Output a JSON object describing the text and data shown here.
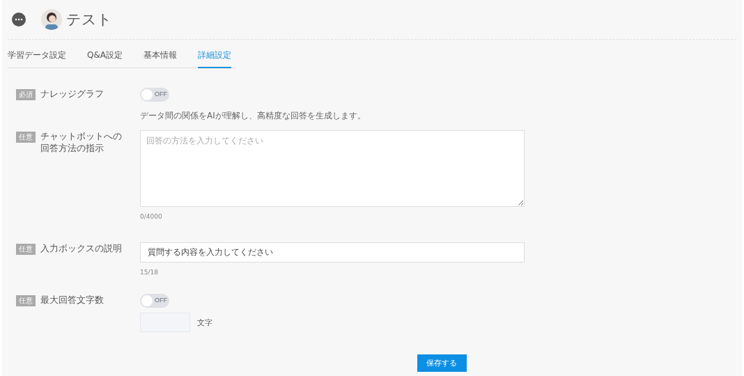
{
  "header": {
    "title": "テスト"
  },
  "tabs": [
    {
      "label": "学習データ設定",
      "selected": false
    },
    {
      "label": "Q&A設定",
      "selected": false
    },
    {
      "label": "基本情報",
      "selected": false
    },
    {
      "label": "詳細設定",
      "selected": true
    }
  ],
  "fields": [
    {
      "kind": "toggle",
      "badge": "必須",
      "label": "ナレッジグラフ",
      "toggle": {
        "on": false,
        "text": "OFF"
      },
      "hint": "データ間の関係をAIが理解し、高精度な回答を生成します。"
    },
    {
      "kind": "textarea",
      "badge": "任意",
      "label": "チャットボットへの回答方法の指示",
      "placeholder": "回答の方法を入力してください",
      "counter": "0/4000"
    },
    {
      "kind": "input",
      "badge": "任意",
      "label": "入力ボックスの説明",
      "value": "質問する内容を入力してください",
      "counter": "15/18"
    },
    {
      "kind": "toggle_number",
      "badge": "任意",
      "label": "最大回答文字数",
      "toggle": {
        "on": false,
        "text": "OFF"
      },
      "unit": "文字"
    }
  ],
  "save_button": "保存する"
}
